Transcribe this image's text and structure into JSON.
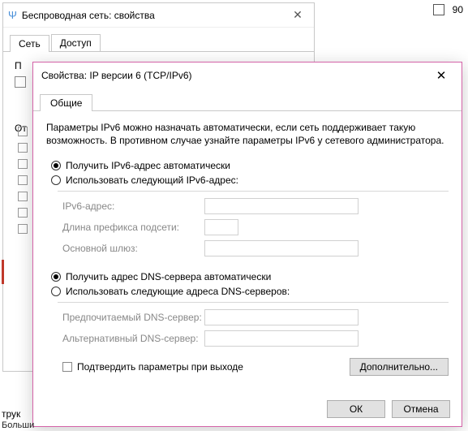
{
  "top_right": {
    "page": "90"
  },
  "outer": {
    "title": "Беспроводная сеть: свойства",
    "tabs": {
      "net": "Сеть",
      "access": "Доступ"
    },
    "conn_label": "П",
    "from_label": "От"
  },
  "inner": {
    "title": "Свойства: IP версии 6 (TCP/IPv6)",
    "tab_general": "Общие",
    "intro": "Параметры IPv6 можно назначать автоматически, если сеть поддерживает такую возможность. В противном случае узнайте параметры IPv6 у сетевого администратора.",
    "ip_auto": "Получить IPv6-адрес автоматически",
    "ip_manual": "Использовать следующий IPv6-адрес:",
    "ip_addr": "IPv6-адрес:",
    "prefix": "Длина префикса подсети:",
    "gateway": "Основной шлюз:",
    "dns_auto": "Получить адрес DNS-сервера автоматически",
    "dns_manual": "Использовать следующие адреса DNS-серверов:",
    "dns_pref": "Предпочитаемый DNS-сервер:",
    "dns_alt": "Альтернативный DNS-сервер:",
    "validate": "Подтвердить параметры при выходе",
    "advanced": "Дополнительно...",
    "ok": "ОК",
    "cancel": "Отмена"
  },
  "bg": {
    "line1": "трук",
    "line2": "Больши"
  }
}
